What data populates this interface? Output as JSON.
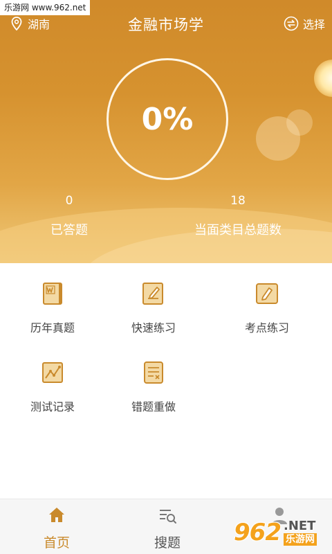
{
  "watermark": "乐游网 www.962.net",
  "header": {
    "location": "湖南",
    "title": "金融市场学",
    "select_label": "选择"
  },
  "progress": {
    "percent_text": "0%"
  },
  "stats": {
    "answered_count": "0",
    "answered_label": "已答题",
    "total_count": "18",
    "total_label": "当面类目总题数"
  },
  "features": [
    {
      "label": "历年真题",
      "icon": "book-icon"
    },
    {
      "label": "快速练习",
      "icon": "edit-note-icon"
    },
    {
      "label": "考点练习",
      "icon": "pencil-card-icon"
    },
    {
      "label": "测试记录",
      "icon": "line-chart-icon"
    },
    {
      "label": "错题重做",
      "icon": "wrong-list-icon"
    }
  ],
  "bottom_nav": {
    "items": [
      {
        "label": "首页",
        "icon": "home-icon",
        "active": true
      },
      {
        "label": "搜题",
        "icon": "search-list-icon",
        "active": false
      },
      {
        "label": "",
        "icon": "user-icon",
        "active": false
      }
    ]
  },
  "brand_badge": {
    "big": "962",
    "net": ".NET",
    "cn": "乐游网"
  },
  "colors": {
    "accent": "#c98a2c",
    "hero_top": "#d08a2a",
    "hero_bottom": "#efc878",
    "icon_fill": "#f3d9a4",
    "icon_stroke": "#c98a2c"
  }
}
